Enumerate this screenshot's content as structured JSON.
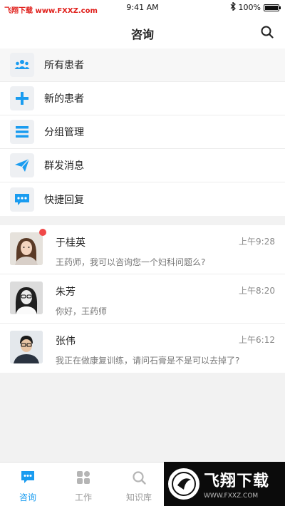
{
  "status_bar": {
    "watermark": "飞翔下载 www.FXXZ.com",
    "time": "9:41 AM",
    "bluetooth_icon": "bluetooth-icon",
    "battery": "100%",
    "battery_level": 1.0
  },
  "nav": {
    "title": "咨询",
    "search_icon": "search-icon"
  },
  "menu": [
    {
      "label": "所有患者",
      "icon": "group-icon"
    },
    {
      "label": "新的患者",
      "icon": "plus-icon"
    },
    {
      "label": "分组管理",
      "icon": "list-icon"
    },
    {
      "label": "群发消息",
      "icon": "send-icon"
    },
    {
      "label": "快捷回复",
      "icon": "chat-dots-icon"
    }
  ],
  "messages": [
    {
      "name": "于桂英",
      "time": "上午9:28",
      "preview": "王药师，我可以咨询您一个妇科问题么?",
      "unread": true
    },
    {
      "name": "朱芳",
      "time": "上午8:20",
      "preview": "你好，王药师",
      "unread": false
    },
    {
      "name": "张伟",
      "time": "上午6:12",
      "preview": "我正在做康复训练，请问石膏是不是可以去掉了?",
      "unread": false
    }
  ],
  "tabs": [
    {
      "label": "咨询",
      "icon": "chat-icon",
      "active": true
    },
    {
      "label": "工作",
      "icon": "grid-icon",
      "active": false
    },
    {
      "label": "知识库",
      "icon": "search-icon",
      "active": false
    }
  ],
  "watermark_badge": {
    "title": "飞翔下载",
    "url": "WWW.FXXZ.COM"
  },
  "colors": {
    "accent": "#1a9cf0",
    "unread": "#f04848"
  }
}
